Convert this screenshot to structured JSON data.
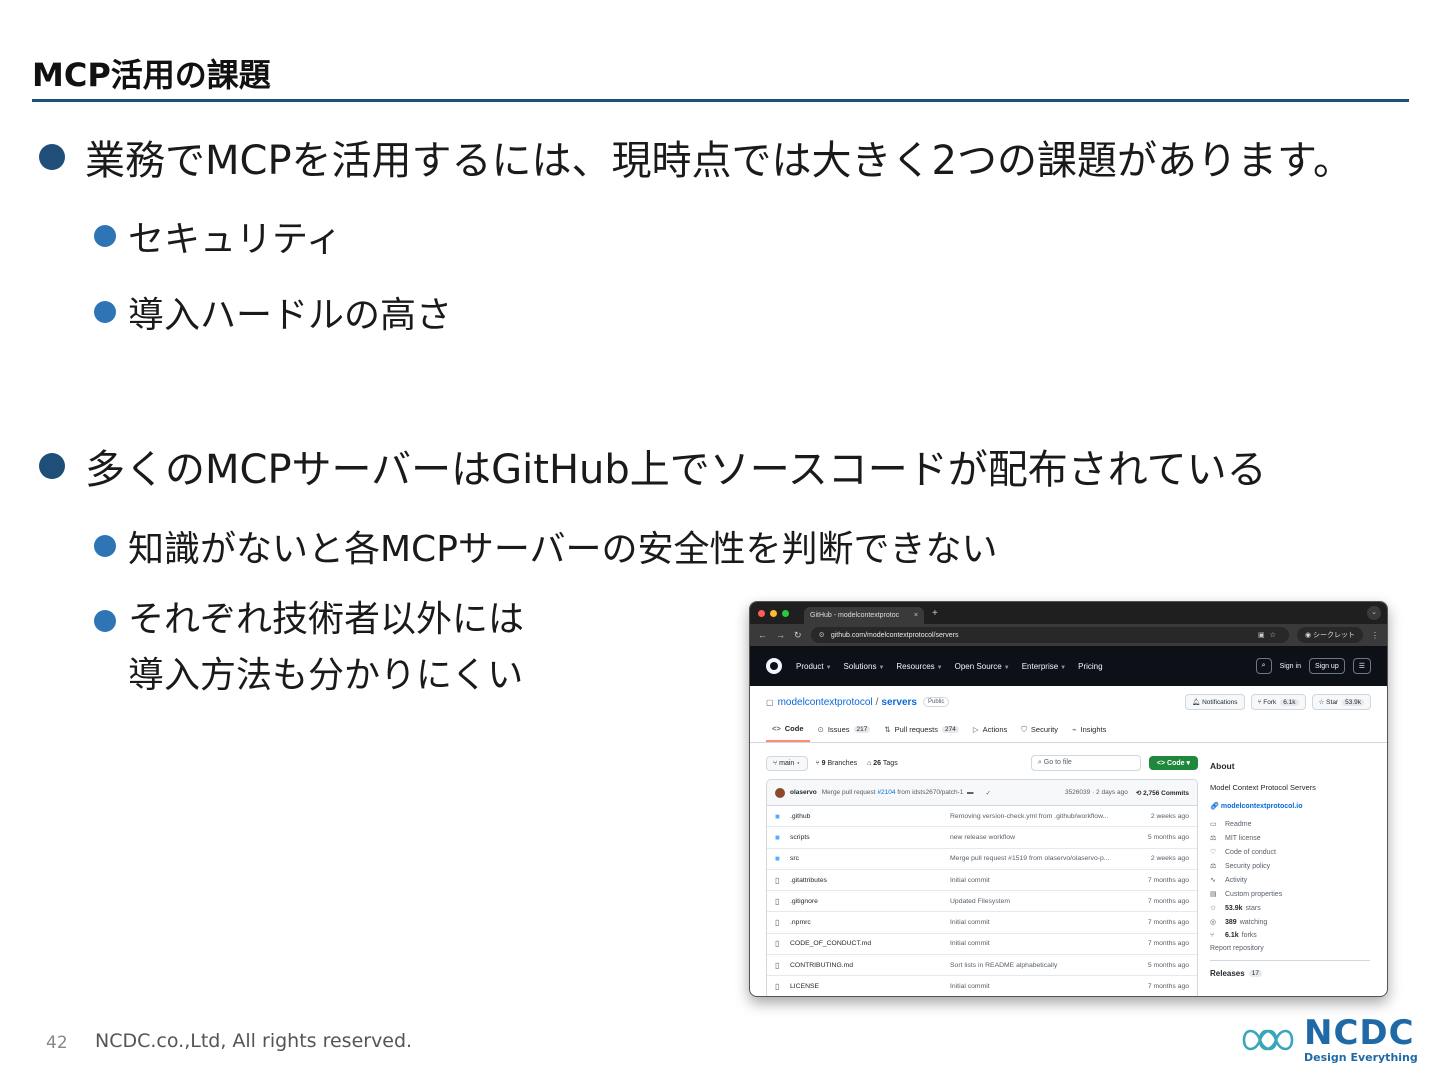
{
  "slide": {
    "title": "MCP活用の課題",
    "bullets": [
      {
        "text": "業務でMCPを活用するには、現時点では大きく2つの課題があります。",
        "children": [
          "セキュリティ",
          "導入ハードルの高さ"
        ]
      },
      {
        "text": "多くのMCPサーバーはGitHub上でソースコードが配布されている",
        "children": [
          "知識がないと各MCPサーバーの安全性を判断できない"
        ],
        "multi_line_child": [
          "それぞれ技術者以外には",
          "導入方法も分かりにくい"
        ]
      }
    ]
  },
  "footer": {
    "page": "42",
    "copyright": "NCDC.co.,Ltd, All rights reserved."
  },
  "logo": {
    "name": "NCDC",
    "tagline": "Design Everything",
    "color": "#1f6aa6"
  },
  "browser": {
    "tab_title": "GitHub - modelcontextprotoc",
    "tab_close": "×",
    "new_tab": "+",
    "url": "github.com/modelcontextprotocol/servers",
    "incognito": "シークレット",
    "gh_nav": [
      "Product",
      "Solutions",
      "Resources",
      "Open Source",
      "Enterprise",
      "Pricing"
    ],
    "sign_in": "Sign in",
    "sign_up": "Sign up",
    "repo": {
      "owner": "modelcontextprotocol",
      "name": "servers",
      "visibility": "Public",
      "notifications": "Notifications",
      "fork_label": "Fork",
      "fork_count": "6.1k",
      "star_label": "Star",
      "star_count": "53.9k"
    },
    "tabs": [
      {
        "label": "Code",
        "count": ""
      },
      {
        "label": "Issues",
        "count": "217"
      },
      {
        "label": "Pull requests",
        "count": "274"
      },
      {
        "label": "Actions",
        "count": ""
      },
      {
        "label": "Security",
        "count": ""
      },
      {
        "label": "Insights",
        "count": ""
      }
    ],
    "branch": "main",
    "branches_count": "9",
    "branches_label": "Branches",
    "tags_count": "26",
    "tags_label": "Tags",
    "go_to_file": "Go to file",
    "code_button": "Code",
    "commit": {
      "author": "olaservo",
      "message_pre": "Merge pull request",
      "pr": "#2104",
      "message_post": "from idsts2670/patch-1",
      "hash_time": "3526039 · 2 days ago",
      "commits": "2,756 Commits"
    },
    "files": [
      {
        "type": "dir",
        "name": ".github",
        "msg": "Removing version-check.yml from .github/workflow...",
        "time": "2 weeks ago"
      },
      {
        "type": "dir",
        "name": "scripts",
        "msg": "new release workflow",
        "time": "5 months ago"
      },
      {
        "type": "dir",
        "name": "src",
        "msg": "Merge pull request #1519 from olaservo/olaservo-p...",
        "time": "2 weeks ago"
      },
      {
        "type": "file",
        "name": ".gitattributes",
        "msg": "Initial commit",
        "time": "7 months ago"
      },
      {
        "type": "file",
        "name": ".gitignore",
        "msg": "Updated Filesystem",
        "time": "7 months ago"
      },
      {
        "type": "file",
        "name": ".npmrc",
        "msg": "Initial commit",
        "time": "7 months ago"
      },
      {
        "type": "file",
        "name": "CODE_OF_CONDUCT.md",
        "msg": "Initial commit",
        "time": "7 months ago"
      },
      {
        "type": "file",
        "name": "CONTRIBUTING.md",
        "msg": "Sort lists in README alphabetically",
        "time": "5 months ago"
      },
      {
        "type": "file",
        "name": "LICENSE",
        "msg": "Initial commit",
        "time": "7 months ago"
      }
    ],
    "about": {
      "heading": "About",
      "description": "Model Context Protocol Servers",
      "link": "modelcontextprotocol.io",
      "items": [
        "Readme",
        "MIT license",
        "Code of conduct",
        "Security policy",
        "Activity",
        "Custom properties"
      ],
      "stars_count": "53.9k",
      "stars_label": "stars",
      "watching_count": "389",
      "watching_label": "watching",
      "forks_count": "6.1k",
      "forks_label": "forks",
      "report": "Report repository",
      "releases_label": "Releases",
      "releases_count": "17"
    }
  }
}
